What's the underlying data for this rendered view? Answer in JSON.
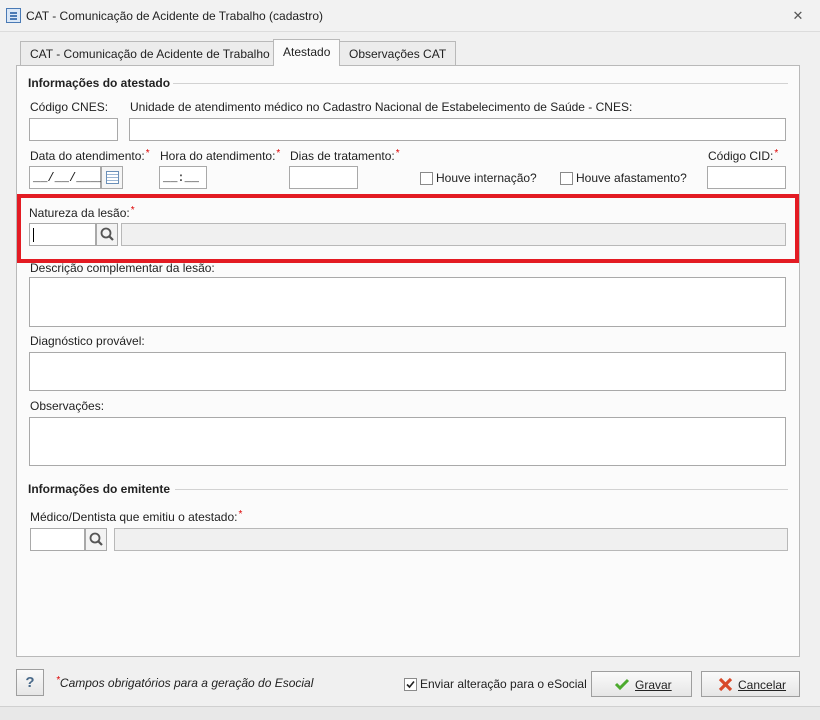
{
  "window": {
    "title": "CAT - Comunicação de Acidente de Trabalho (cadastro)"
  },
  "tabs": [
    {
      "label": "CAT - Comunicação de Acidente de Trabalho"
    },
    {
      "label": "Atestado"
    },
    {
      "label": "Observações CAT"
    }
  ],
  "active_tab": "Atestado",
  "atestado": {
    "section_title": "Informações do atestado",
    "codigo_cnes_label": "Código CNES:",
    "unidade_label": "Unidade de atendimento médico no Cadastro Nacional de Estabelecimento de Saúde - CNES:",
    "data_atendimento_label": "Data do atendimento:",
    "data_atendimento_value": "__/__/____",
    "hora_atendimento_label": "Hora do atendimento:",
    "hora_atendimento_value": "__:__",
    "dias_tratamento_label": "Dias de tratamento:",
    "houve_internacao_label": "Houve internação?",
    "houve_afastamento_label": "Houve afastamento?",
    "codigo_cid_label": "Código CID:",
    "natureza_lesao_label": "Natureza da lesão:",
    "descricao_complementar_label": "Descrição complementar da lesão:",
    "diagnostico_label": "Diagnóstico provável:",
    "observacoes_label": "Observações:"
  },
  "emitente": {
    "section_title": "Informações do emitente",
    "medico_label": "Médico/Dentista que emitiu o atestado:"
  },
  "required_mark": "*",
  "footer": {
    "help_label": "?",
    "footnote": "Campos obrigatórios para a geração do Esocial",
    "enviar_label": "Enviar alteração para o eSocial",
    "enviar_checked": true,
    "gravar_label": "Gravar",
    "cancelar_label": "Cancelar"
  },
  "colors": {
    "highlight": "#e31b23",
    "required": "#dd0000",
    "gravar_icon": "#4caa2e",
    "cancelar_icon": "#d84a2a"
  },
  "icons": [
    "app-form-icon",
    "close-icon",
    "calendar-icon",
    "search-icon",
    "check-icon",
    "cancel-x-icon",
    "help-icon"
  ]
}
